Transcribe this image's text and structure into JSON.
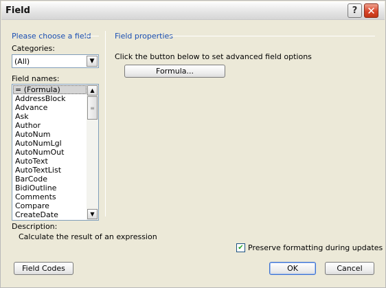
{
  "window": {
    "title": "Field",
    "help_label": "?",
    "close_label": "✕"
  },
  "left": {
    "section_title": "Please choose a field",
    "categories_label": "Categories:",
    "categories_value": "(All)",
    "field_names_label": "Field names:",
    "field_names": [
      "= (Formula)",
      "AddressBlock",
      "Advance",
      "Ask",
      "Author",
      "AutoNum",
      "AutoNumLgl",
      "AutoNumOut",
      "AutoText",
      "AutoTextList",
      "BarCode",
      "BidiOutline",
      "Comments",
      "Compare",
      "CreateDate"
    ],
    "selected_field": "= (Formula)"
  },
  "right": {
    "section_title": "Field properties",
    "instruction": "Click the button below to set advanced field options",
    "formula_button": "Formula..."
  },
  "description": {
    "label": "Description:",
    "text": "Calculate the result of an expression"
  },
  "options": {
    "preserve_formatting_label": "Preserve formatting during updates",
    "preserve_formatting_checked": true
  },
  "buttons": {
    "field_codes": "Field Codes",
    "ok": "OK",
    "cancel": "Cancel"
  },
  "icons": {
    "help": "help-icon",
    "close": "close-icon",
    "dropdown": "chevron-down-icon",
    "scroll_up": "scroll-up-icon",
    "scroll_down": "scroll-down-icon",
    "check": "checkmark-icon"
  }
}
